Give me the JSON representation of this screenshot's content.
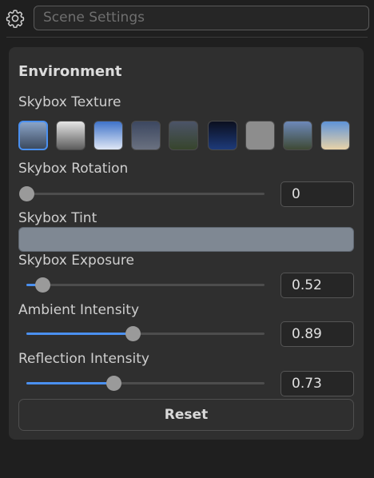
{
  "search": {
    "placeholder": "Scene Settings"
  },
  "section": {
    "title": "Environment"
  },
  "skybox_texture": {
    "label": "Skybox Texture",
    "selected_index": 0,
    "thumbnails": [
      {
        "name": "city-street",
        "colors": [
          "#8aa3c7",
          "#3c4a5e"
        ]
      },
      {
        "name": "cloudy-overcast",
        "colors": [
          "#e6e6e6",
          "#5c5c5c"
        ]
      },
      {
        "name": "blue-sky-clouds",
        "colors": [
          "#3f73c9",
          "#dfe7f5"
        ]
      },
      {
        "name": "dusk-gradient",
        "colors": [
          "#3c4760",
          "#6a7180"
        ]
      },
      {
        "name": "field-horizon",
        "colors": [
          "#4c5468",
          "#37452c"
        ]
      },
      {
        "name": "night-sky",
        "colors": [
          "#0b0f1f",
          "#1d3a7a"
        ]
      },
      {
        "name": "plain-gray",
        "colors": [
          "#8d8d8d",
          "#8d8d8d"
        ]
      },
      {
        "name": "open-landscape",
        "colors": [
          "#6d89b9",
          "#3f4a35"
        ]
      },
      {
        "name": "sunny-day",
        "colors": [
          "#5e93d8",
          "#e9d3a8"
        ]
      }
    ]
  },
  "skybox_rotation": {
    "label": "Skybox Rotation",
    "value": "0",
    "fraction": 0.0
  },
  "skybox_tint": {
    "label": "Skybox Tint",
    "color": "#7f8893"
  },
  "skybox_exposure": {
    "label": "Skybox Exposure",
    "value": "0.52",
    "fraction": 0.067
  },
  "ambient_intensity": {
    "label": "Ambient Intensity",
    "value": "0.89",
    "fraction": 0.446
  },
  "reflection_intensity": {
    "label": "Reflection Intensity",
    "value": "0.73",
    "fraction": 0.366
  },
  "reset": {
    "label": "Reset"
  },
  "colors": {
    "accent": "#4a90f0",
    "panel": "#2f2f2f",
    "background": "#1f1f1f"
  }
}
